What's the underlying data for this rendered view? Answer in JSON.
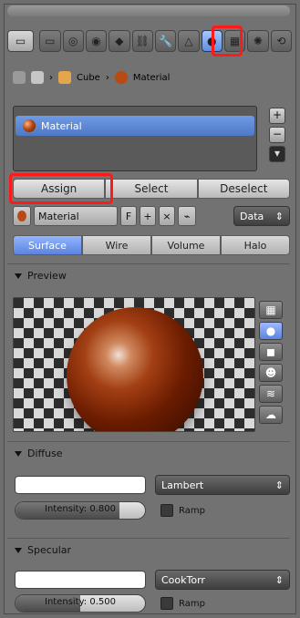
{
  "context_tabs": [
    {
      "name": "render-tab",
      "glyph": "▭"
    },
    {
      "name": "scene-tab",
      "glyph": "◎"
    },
    {
      "name": "world-tab",
      "glyph": "◉"
    },
    {
      "name": "object-tab",
      "glyph": "◆"
    },
    {
      "name": "constraints-tab",
      "glyph": "⛓"
    },
    {
      "name": "modifiers-tab",
      "glyph": "🔧"
    },
    {
      "name": "data-tab",
      "glyph": "△"
    },
    {
      "name": "bones-tab",
      "glyph": "⛭"
    },
    {
      "name": "material-tab",
      "glyph": "●"
    },
    {
      "name": "texture-tab",
      "glyph": "▦"
    },
    {
      "name": "particles-tab",
      "glyph": "✺"
    },
    {
      "name": "physics-tab",
      "glyph": "⟲"
    }
  ],
  "breadcrumb": {
    "object": "Cube",
    "material": "Material"
  },
  "material_slots": {
    "selected": "Material"
  },
  "slot_actions": {
    "assign": "Assign",
    "select": "Select",
    "deselect": "Deselect"
  },
  "material_datablock": {
    "name": "Material",
    "link": "Data"
  },
  "type_tabs": [
    "Surface",
    "Wire",
    "Volume",
    "Halo"
  ],
  "preview": {
    "title": "Preview"
  },
  "diffuse": {
    "title": "Diffuse",
    "shader": "Lambert",
    "intensity_label": "Intensity: 0.800",
    "intensity_value": 0.8,
    "ramp_label": "Ramp"
  },
  "specular": {
    "title": "Specular",
    "shader": "CookTorr",
    "intensity_label": "Intensity: 0.500",
    "intensity_value": 0.5,
    "ramp_label": "Ramp"
  },
  "colors": {
    "accent": "#5b84de",
    "highlight": "#ff1a1a",
    "panel": "#727272"
  }
}
